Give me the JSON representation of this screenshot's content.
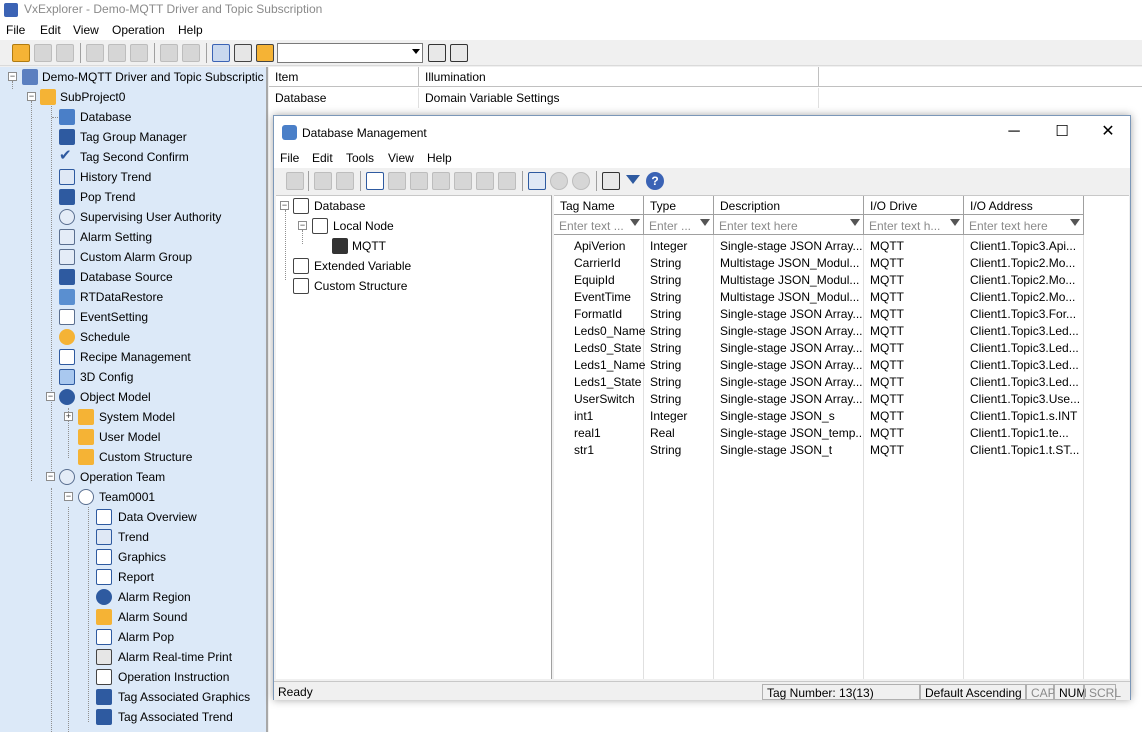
{
  "app": {
    "title": "VxExplorer - Demo-MQTT Driver and Topic Subscription"
  },
  "menu": [
    "File",
    "Edit",
    "View",
    "Operation",
    "Help"
  ],
  "toolbar": {
    "combo_value": ""
  },
  "project_tree": {
    "root": "Demo-MQTT Driver and Topic Subscriptic",
    "subproject": "SubProject0",
    "items": [
      "Database",
      "Tag Group Manager",
      "Tag Second Confirm",
      "History Trend",
      "Pop Trend",
      "Supervising User Authority",
      "Alarm Setting",
      "Custom Alarm Group",
      "Database Source",
      "RTDataRestore",
      "EventSetting",
      "Schedule",
      "Recipe Management",
      "3D Config",
      "Object Model"
    ],
    "object_model_children": [
      "System Model",
      "User Model",
      "Custom Structure"
    ],
    "operation_team": "Operation Team",
    "team": "Team0001",
    "team_children": [
      "Data Overview",
      "Trend",
      "Graphics",
      "Report",
      "Alarm Region",
      "Alarm Sound",
      "Alarm Pop",
      "Alarm Real-time Print",
      "Operation Instruction",
      "Tag Associated Graphics",
      "Tag Associated Trend"
    ]
  },
  "right_table": {
    "headers": [
      "Item",
      "Illumination"
    ],
    "rows": [
      [
        "Database",
        "Domain Variable Settings"
      ]
    ]
  },
  "dialog": {
    "title": "Database Management",
    "menu": [
      "File",
      "Edit",
      "Tools",
      "View",
      "Help"
    ],
    "tree": {
      "root": "Database",
      "local_node": "Local Node",
      "mqtt": "MQTT",
      "extended": "Extended Variable",
      "custom": "Custom Structure"
    },
    "columns": [
      "Tag Name",
      "Type",
      "Description",
      "I/O Drive",
      "I/O Address"
    ],
    "filters": [
      "Enter text ...",
      "Enter ...",
      "Enter text here",
      "Enter text h...",
      "Enter text here"
    ],
    "rows": [
      [
        "ApiVerion",
        "Integer",
        "Single-stage JSON Array...",
        "MQTT",
        "Client1.Topic3.Api..."
      ],
      [
        "CarrierId",
        "String",
        "Multistage JSON_Modul...",
        "MQTT",
        "Client1.Topic2.Mo..."
      ],
      [
        "EquipId",
        "String",
        "Multistage JSON_Modul...",
        "MQTT",
        "Client1.Topic2.Mo..."
      ],
      [
        "EventTime",
        "String",
        "Multistage JSON_Modul...",
        "MQTT",
        "Client1.Topic2.Mo..."
      ],
      [
        "FormatId",
        "String",
        "Single-stage JSON Array...",
        "MQTT",
        "Client1.Topic3.For..."
      ],
      [
        "Leds0_Name",
        "String",
        "Single-stage JSON Array...",
        "MQTT",
        "Client1.Topic3.Led..."
      ],
      [
        "Leds0_State",
        "String",
        "Single-stage JSON Array...",
        "MQTT",
        "Client1.Topic3.Led..."
      ],
      [
        "Leds1_Name",
        "String",
        "Single-stage JSON Array...",
        "MQTT",
        "Client1.Topic3.Led..."
      ],
      [
        "Leds1_State",
        "String",
        "Single-stage JSON Array...",
        "MQTT",
        "Client1.Topic3.Led..."
      ],
      [
        "UserSwitch",
        "String",
        "Single-stage JSON Array...",
        "MQTT",
        "Client1.Topic3.Use..."
      ],
      [
        "int1",
        "Integer",
        "Single-stage JSON_s",
        "MQTT",
        "Client1.Topic1.s.INT"
      ],
      [
        "real1",
        "Real",
        "Single-stage JSON_temp...",
        "MQTT",
        "Client1.Topic1.te..."
      ],
      [
        "str1",
        "String",
        "Single-stage JSON_t",
        "MQTT",
        "Client1.Topic1.t.ST..."
      ]
    ],
    "status": {
      "ready": "Ready",
      "tag_number": "Tag Number: 13(13)",
      "sort": "Default Ascending",
      "cap": "CAP",
      "num": "NUM",
      "scrl": "SCRL"
    }
  },
  "colors": {
    "tree_bg": "#dce9f8",
    "folder": "#f5b335",
    "accent": "#3b63b5"
  }
}
